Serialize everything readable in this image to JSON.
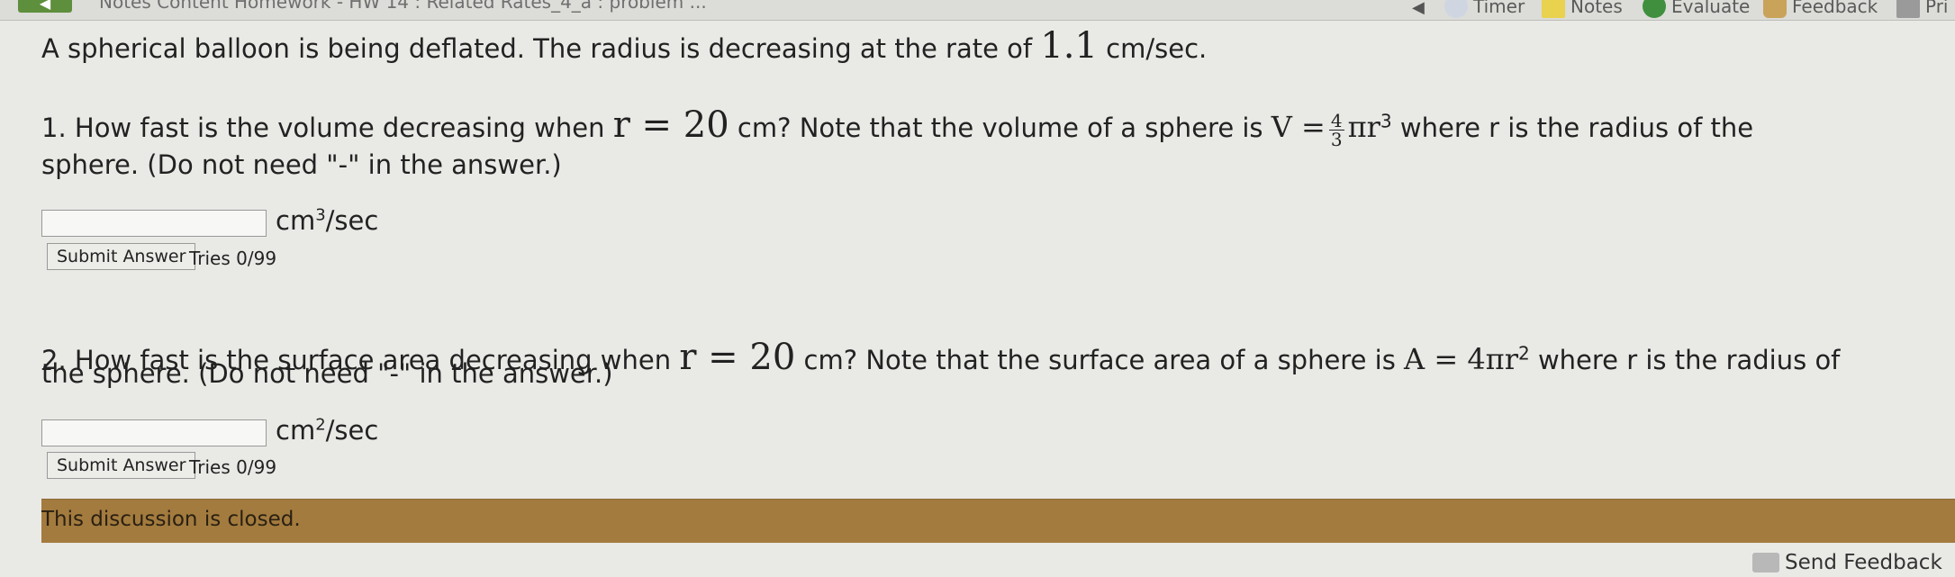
{
  "toolbar": {
    "breadcrumb": "Notes Content   Homework - HW 14 : Related Rates_4_a : problem ...",
    "timer": "Timer",
    "notes": "Notes",
    "evaluate": "Evaluate",
    "feedback": "Feedback",
    "print": "Pri"
  },
  "problem": {
    "intro_prefix": "A spherical balloon is being deflated. The radius is decreasing at the rate of",
    "rate_value": "1.1",
    "rate_unit": "cm/sec.",
    "q1": {
      "prefix": "1. How fast is the volume decreasing when",
      "r_expr": "r = 20",
      "middle": "cm? Note that the volume of a sphere is",
      "formula_lhs": "V =",
      "frac_num": "4",
      "frac_den": "3",
      "formula_rest": "πr",
      "formula_exp": "3",
      "suffix": "where r is the radius of the",
      "line2": "sphere. (Do not need \"-\" in the answer.)",
      "unit_base": "cm",
      "unit_exp": "3",
      "unit_tail": "/sec",
      "input_value": "",
      "submit_label": "Submit Answer",
      "tries": "Tries 0/99"
    },
    "q2": {
      "prefix": "2. How fast is the surface area decreasing when",
      "r_expr": "r = 20",
      "middle": "cm? Note that the surface area of a sphere is",
      "formula_lhs": "A = 4πr",
      "formula_exp": "2",
      "suffix": "where r is the radius of",
      "line2": "the sphere. (Do not need \"-\" in the answer.)",
      "unit_base": "cm",
      "unit_exp": "2",
      "unit_tail": "/sec",
      "input_value": "",
      "submit_label": "Submit Answer",
      "tries": "Tries 0/99"
    }
  },
  "discussion": {
    "closed_text": "This discussion is closed."
  },
  "footer": {
    "send_feedback": "Send Feedback"
  }
}
